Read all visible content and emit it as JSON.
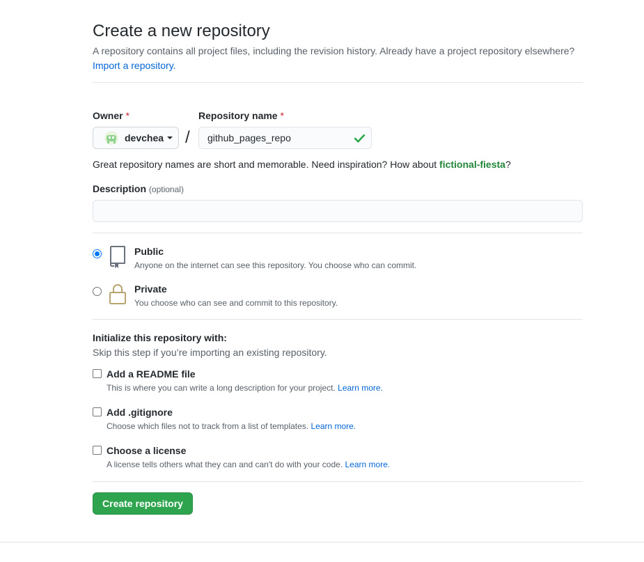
{
  "header": {
    "title": "Create a new repository",
    "subtitle": "A repository contains all project files, including the revision history. Already have a project repository elsewhere?",
    "import_link": "Import a repository."
  },
  "owner": {
    "label": "Owner",
    "required_mark": "*",
    "value": "devchea"
  },
  "repo_name": {
    "label": "Repository name",
    "required_mark": "*",
    "value": "github_pages_repo",
    "separator": "/"
  },
  "hint": {
    "text": "Great repository names are short and memorable. Need inspiration? How about ",
    "suggestion": "fictional-fiesta",
    "suffix": "?"
  },
  "description": {
    "label": "Description",
    "optional": "(optional)",
    "value": ""
  },
  "visibility": {
    "selected": "public",
    "options": [
      {
        "id": "public",
        "title": "Public",
        "desc": "Anyone on the internet can see this repository. You choose who can commit."
      },
      {
        "id": "private",
        "title": "Private",
        "desc": "You choose who can see and commit to this repository."
      }
    ]
  },
  "init": {
    "title": "Initialize this repository with:",
    "subtitle": "Skip this step if you’re importing an existing repository.",
    "options": [
      {
        "title": "Add a README file",
        "desc": "This is where you can write a long description for your project.",
        "link": "Learn more."
      },
      {
        "title": "Add .gitignore",
        "desc": "Choose which files not to track from a list of templates.",
        "link": "Learn more."
      },
      {
        "title": "Choose a license",
        "desc": "A license tells others what they can and can't do with your code.",
        "link": "Learn more."
      }
    ]
  },
  "submit": {
    "label": "Create repository"
  },
  "colors": {
    "accent": "#0366d6",
    "success": "#2ea44f",
    "required": "#cb2431",
    "suggestion": "#22863a"
  },
  "icons": [
    "owner-avatar-icon",
    "checkmark-icon",
    "repo-icon",
    "lock-icon"
  ]
}
